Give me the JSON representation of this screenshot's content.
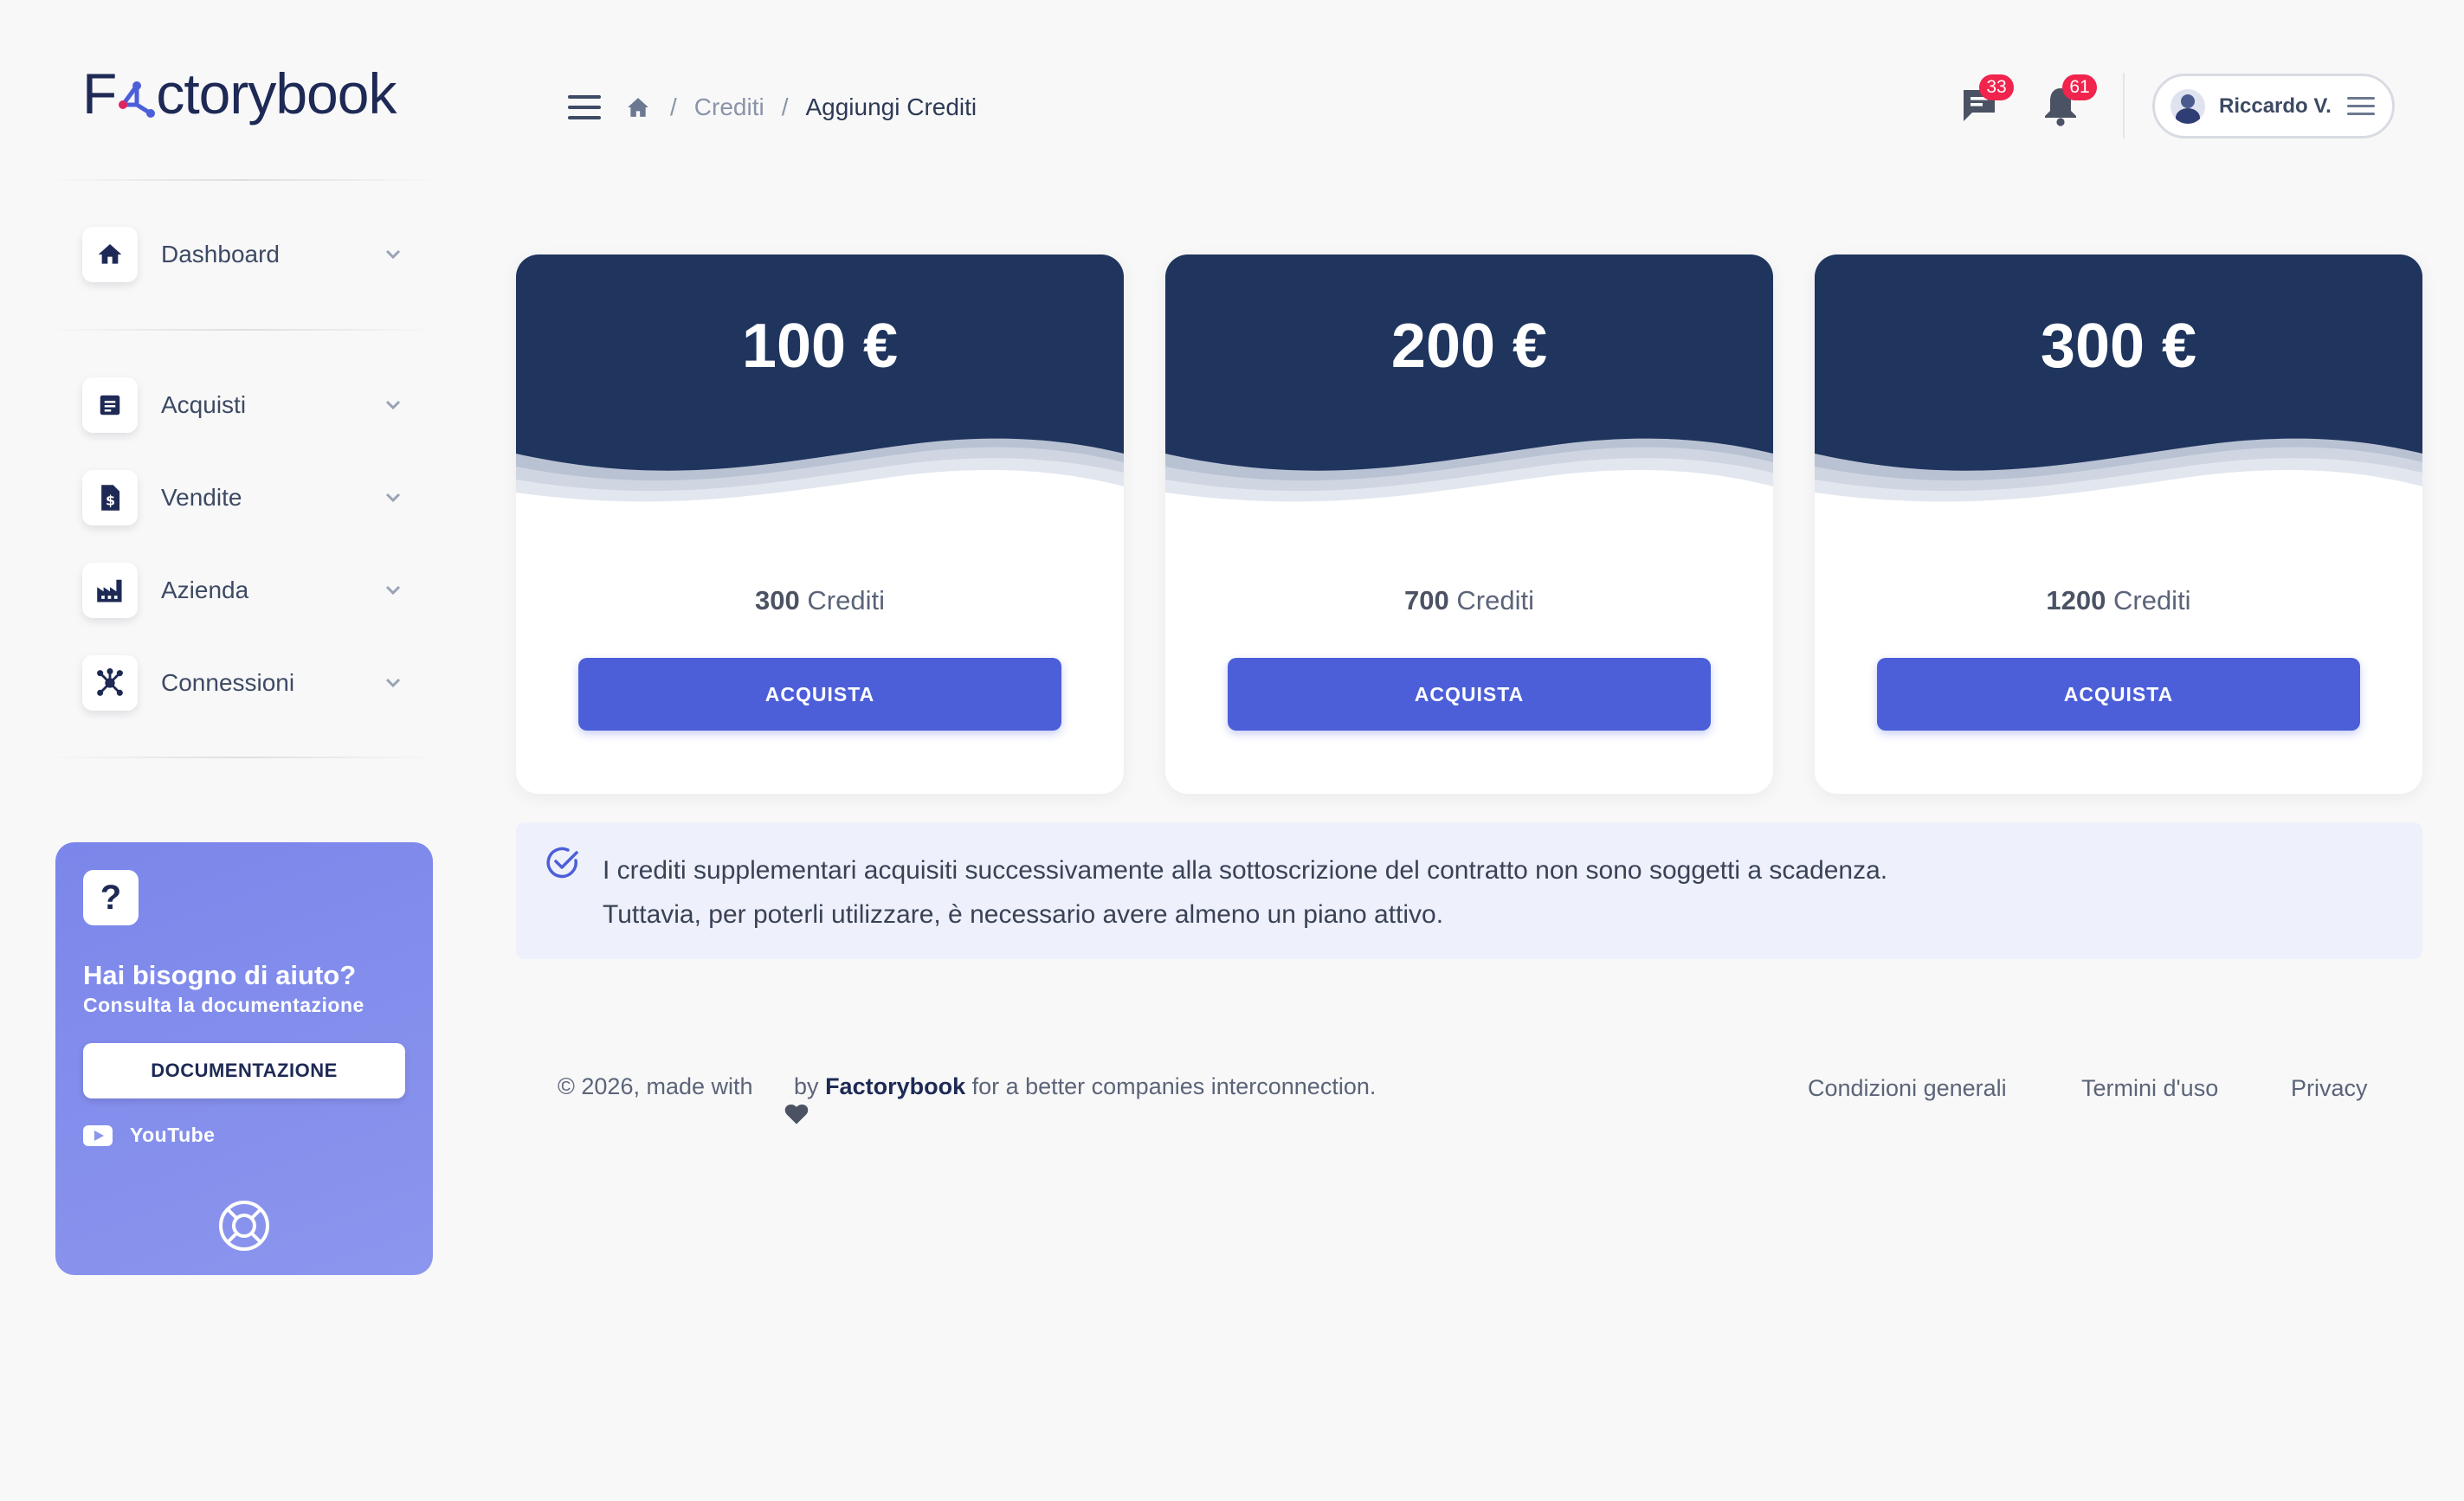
{
  "brand": {
    "logo_pre": "F",
    "logo_post": "ctorybook"
  },
  "sidebar": {
    "items": [
      {
        "label": "Dashboard"
      },
      {
        "label": "Acquisti"
      },
      {
        "label": "Vendite"
      },
      {
        "label": "Azienda"
      },
      {
        "label": "Connessioni"
      }
    ],
    "help": {
      "q_mark": "?",
      "title": "Hai bisogno di aiuto?",
      "subtitle": "Consulta la documentazione",
      "button": "DOCUMENTAZIONE",
      "youtube": "YouTube"
    }
  },
  "breadcrumb": {
    "sep": "/",
    "parent": "Crediti",
    "current": "Aggiungi Crediti"
  },
  "header": {
    "messages_count": "33",
    "notifications_count": "61",
    "user_name": "Riccardo V."
  },
  "plans": [
    {
      "price": "100 €",
      "credits_amount": "300",
      "credits_label": " Crediti",
      "button": "ACQUISTA"
    },
    {
      "price": "200 €",
      "credits_amount": "700",
      "credits_label": " Crediti",
      "button": "ACQUISTA"
    },
    {
      "price": "300 €",
      "credits_amount": "1200",
      "credits_label": " Crediti",
      "button": "ACQUISTA"
    }
  ],
  "info": {
    "line1": "I crediti supplementari acquisiti successivamente alla sottoscrizione del contratto non sono soggetti a scadenza.",
    "line2": "Tuttavia, per poterli utilizzare, è necessario avere almeno un piano attivo."
  },
  "footer": {
    "prefix": "© 2026, made with",
    "by": " by ",
    "brand": "Factorybook",
    "suffix": " for a better companies interconnection.",
    "links": [
      "Condizioni generali",
      "Termini d'uso",
      "Privacy"
    ]
  },
  "colors": {
    "card_header": "#1f355e",
    "button": "#4c5fd9",
    "badge": "#f0244d",
    "help_card": "#8c96ee"
  }
}
